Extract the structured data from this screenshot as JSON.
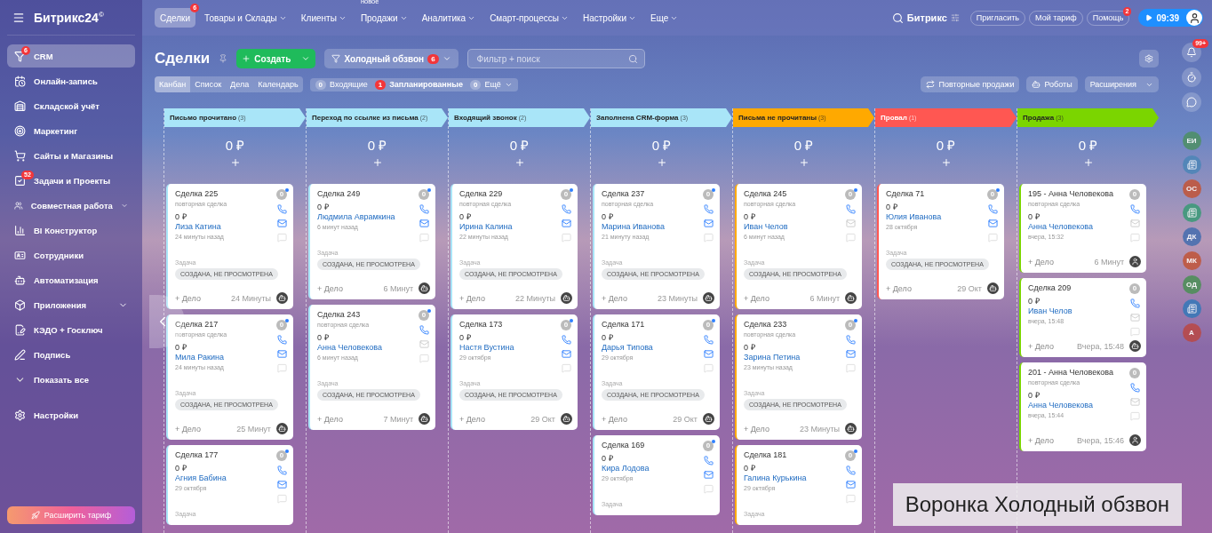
{
  "sidebar": {
    "logo": "Битрикс24",
    "logo_mark": "©",
    "items": [
      {
        "label": "CRM",
        "badge": "6",
        "selected": true,
        "has_submenu": false
      },
      {
        "label": "Онлайн-запись",
        "selected": false,
        "has_submenu": false
      },
      {
        "label": "Складской учёт",
        "selected": false,
        "has_submenu": false
      },
      {
        "label": "Маркетинг",
        "selected": false,
        "has_submenu": false
      },
      {
        "label": "Сайты и Магазины",
        "selected": false,
        "has_submenu": false
      },
      {
        "label": "Задачи и Проекты",
        "badge": "52",
        "selected": false,
        "has_submenu": false
      },
      {
        "label": "Совместная работа",
        "selected": false,
        "has_submenu": true
      },
      {
        "label": "BI Конструктор",
        "selected": false,
        "has_submenu": false
      },
      {
        "label": "Сотрудники",
        "selected": false,
        "has_submenu": false
      },
      {
        "label": "Автоматизация",
        "selected": false,
        "has_submenu": false
      },
      {
        "label": "Приложения",
        "selected": false,
        "has_submenu": true
      },
      {
        "label": "КЭДО + Госключ",
        "selected": false,
        "has_submenu": false
      },
      {
        "label": "Подпись",
        "selected": false,
        "has_submenu": false
      }
    ],
    "show_all": "Показать все",
    "settings": "Настройки",
    "upgrade": "Расширить тариф"
  },
  "nav": {
    "items": [
      {
        "label": "Сделки",
        "badge": "6",
        "selected": true,
        "dropdown": false
      },
      {
        "label": "Товары и Склады",
        "selected": false,
        "dropdown": true
      },
      {
        "label": "Клиенты",
        "selected": false,
        "dropdown": true
      },
      {
        "label": "Продажи",
        "note": "новое",
        "selected": false,
        "dropdown": true
      },
      {
        "label": "Аналитика",
        "selected": false,
        "dropdown": true
      },
      {
        "label": "Смарт-процессы",
        "selected": false,
        "dropdown": true
      },
      {
        "label": "Настройки",
        "selected": false,
        "dropdown": true
      },
      {
        "label": "Еще",
        "selected": false,
        "dropdown": true
      }
    ],
    "portal": "Битрикс",
    "buttons": [
      {
        "label": "Пригласить"
      },
      {
        "label": "Мой тариф"
      },
      {
        "label": "Помощь",
        "badge": "2"
      }
    ],
    "time": "09:39"
  },
  "toolbar": {
    "title": "Сделки",
    "create": "Создать",
    "funnel": "Холодный обзвон",
    "funnel_badge": "6",
    "filter_placeholder": "Фильтр + поиск",
    "views": [
      {
        "label": "Канбан",
        "selected": true
      },
      {
        "label": "Список",
        "selected": false
      },
      {
        "label": "Дела",
        "selected": false
      },
      {
        "label": "Календарь",
        "selected": false
      }
    ],
    "counters": [
      {
        "count": "0",
        "label": "Входящие",
        "alert": false,
        "dropdown": false
      },
      {
        "count": "1",
        "label": "Запланированные",
        "alert": true,
        "dropdown": false
      },
      {
        "count": "0",
        "label": "Ещё",
        "alert": false,
        "dropdown": true
      }
    ],
    "actions": [
      "Повторные продажи",
      "Роботы",
      "Расширения"
    ]
  },
  "board": {
    "columns": [
      {
        "title": "Письмо прочитано",
        "count": "(3)",
        "color": "#a9e5f8",
        "sum": "0 ₽",
        "cards": [
          {
            "title": "Сделка 225",
            "subtitle": "повторная сделка",
            "amount": "0 ₽",
            "contact": "Лиза Катина",
            "time": "24 минуты назад",
            "task_label": "Задача",
            "task_status": "СОЗДАНА, НЕ ПРОСМОТРЕНА",
            "add": "+ Дело",
            "footer_time": "24 Минуты",
            "kind": "robot",
            "counter": "0",
            "unread": true,
            "email_active": true
          },
          {
            "title": "Сделка 217",
            "subtitle": "повторная сделка",
            "amount": "0 ₽",
            "contact": "Мила Ракина",
            "time": "24 минуты назад",
            "task_label": "Задача",
            "task_status": "СОЗДАНА, НЕ ПРОСМОТРЕНА",
            "add": "+ Дело",
            "footer_time": "25 Минут",
            "kind": "robot",
            "counter": "0",
            "unread": true,
            "email_active": true
          },
          {
            "title": "Сделка 177",
            "amount": "0 ₽",
            "contact": "Агния Бабина",
            "time": "29 октября",
            "task_label": "Задача",
            "counter": "0",
            "unread": true,
            "email_active": true
          }
        ]
      },
      {
        "title": "Переход по ссылке из письма",
        "count": "(2)",
        "color": "#a9e5f8",
        "sum": "0 ₽",
        "cards": [
          {
            "title": "Сделка 249",
            "amount": "0 ₽",
            "contact": "Людмила Аврамкина",
            "time": "6 минут назад",
            "task_label": "Задача",
            "task_status": "СОЗДАНА, НЕ ПРОСМОТРЕНА",
            "add": "+ Дело",
            "footer_time": "6 Минут",
            "kind": "robot",
            "counter": "0",
            "unread": true,
            "email_active": true
          },
          {
            "title": "Сделка 243",
            "subtitle": "повторная сделка",
            "amount": "0 ₽",
            "contact": "Анна Человекова",
            "time": "6 минут назад",
            "task_label": "Задача",
            "task_status": "СОЗДАНА, НЕ ПРОСМОТРЕНА",
            "add": "+ Дело",
            "footer_time": "7 Минут",
            "kind": "robot",
            "counter": "0",
            "unread": true,
            "email_active": false
          }
        ]
      },
      {
        "title": "Входящий звонок",
        "count": "(2)",
        "color": "#a9e5f8",
        "sum": "0 ₽",
        "cards": [
          {
            "title": "Сделка 229",
            "subtitle": "повторная сделка",
            "amount": "0 ₽",
            "contact": "Ирина Калина",
            "time": "22 минуты назад",
            "task_label": "Задача",
            "task_status": "СОЗДАНА, НЕ ПРОСМОТРЕНА",
            "add": "+ Дело",
            "footer_time": "22 Минуты",
            "kind": "robot",
            "counter": "0",
            "unread": true,
            "email_active": true
          },
          {
            "title": "Сделка 173",
            "amount": "0 ₽",
            "contact": "Настя Вустина",
            "time": "29 октября",
            "task_label": "Задача",
            "task_status": "СОЗДАНА, НЕ ПРОСМОТРЕНА",
            "add": "+ Дело",
            "footer_time": "29 Окт",
            "kind": "robot",
            "counter": "0",
            "unread": true,
            "email_active": true
          }
        ]
      },
      {
        "title": "Заполнена CRM-форма",
        "count": "(3)",
        "color": "#a9e5f8",
        "sum": "0 ₽",
        "cards": [
          {
            "title": "Сделка 237",
            "subtitle": "повторная сделка",
            "amount": "0 ₽",
            "contact": "Марина Иванова",
            "time": "21 минуту назад",
            "task_label": "Задача",
            "task_status": "СОЗДАНА, НЕ ПРОСМОТРЕНА",
            "add": "+ Дело",
            "footer_time": "23 Минуты",
            "kind": "robot",
            "counter": "0",
            "unread": true,
            "email_active": true
          },
          {
            "title": "Сделка 171",
            "amount": "0 ₽",
            "contact": "Дарья Типова",
            "time": "29 октября",
            "task_label": "Задача",
            "task_status": "СОЗДАНА, НЕ ПРОСМОТРЕНА",
            "add": "+ Дело",
            "footer_time": "29 Окт",
            "kind": "robot",
            "counter": "0",
            "unread": true,
            "email_active": true
          },
          {
            "title": "Сделка 169",
            "amount": "0 ₽",
            "contact": "Кира Лодова",
            "time": "29 октября",
            "task_label": "Задача",
            "counter": "0",
            "unread": true,
            "email_active": true
          }
        ]
      },
      {
        "title": "Письма не прочитаны",
        "count": "(3)",
        "color": "#ffa900",
        "sum": "0 ₽",
        "cards": [
          {
            "title": "Сделка 245",
            "subtitle": "повторная сделка",
            "amount": "0 ₽",
            "contact": "Иван Челов",
            "time": "6 минут назад",
            "task_label": "Задача",
            "task_status": "СОЗДАНА, НЕ ПРОСМОТРЕНА",
            "add": "+ Дело",
            "footer_time": "6 Минут",
            "kind": "robot",
            "counter": "0",
            "unread": true,
            "email_active": false
          },
          {
            "title": "Сделка 233",
            "subtitle": "повторная сделка",
            "amount": "0 ₽",
            "contact": "Зарина Петина",
            "time": "23 минуты назад",
            "task_label": "Задача",
            "task_status": "СОЗДАНА, НЕ ПРОСМОТРЕНА",
            "add": "+ Дело",
            "footer_time": "23 Минуты",
            "kind": "robot",
            "counter": "0",
            "unread": true,
            "email_active": true
          },
          {
            "title": "Сделка 181",
            "amount": "0 ₽",
            "contact": "Галина Курькина",
            "time": "29 октября",
            "task_label": "Задача",
            "counter": "0",
            "unread": true,
            "email_active": true
          }
        ]
      },
      {
        "title": "Провал",
        "count": "(1)",
        "color": "#ff5752",
        "sum": "0 ₽",
        "cards": [
          {
            "title": "Сделка 71",
            "amount": "0 ₽",
            "contact": "Юлия Иванова",
            "time": "28 октября",
            "task_label": "Задача",
            "task_status": "СОЗДАНА, НЕ ПРОСМОТРЕНА",
            "add": "+ Дело",
            "footer_time": "29 Окт",
            "kind": "robot",
            "counter": "0",
            "unread": true,
            "email_active": true
          }
        ]
      },
      {
        "title": "Продажа",
        "count": "(3)",
        "color": "#7bd500",
        "sum": "0 ₽",
        "cards": [
          {
            "title": "195 - Анна Человекова",
            "subtitle": "повторная сделка",
            "amount": "0 ₽",
            "contact": "Анна Человекова",
            "time": "вчера, 15:32",
            "add": "+ Дело",
            "footer_time": "6 Минут",
            "kind": "person",
            "counter": "0",
            "unread": false,
            "email_active": false
          },
          {
            "title": "Сделка 209",
            "amount": "0 ₽",
            "contact": "Иван Челов",
            "time": "вчера, 15:48",
            "add": "+ Дело",
            "footer_time": "Вчера, 15:48",
            "kind": "robot",
            "counter": "0",
            "unread": false,
            "email_active": false
          },
          {
            "title": "201 - Анна Человекова",
            "subtitle": "повторная сделка",
            "amount": "0 ₽",
            "contact": "Анна Человекова",
            "time": "вчера, 15:44",
            "add": "+ Дело",
            "footer_time": "Вчера, 15:46",
            "kind": "person",
            "counter": "0",
            "unread": false,
            "email_active": false
          }
        ]
      }
    ]
  },
  "rail": {
    "bell_badge": "99+",
    "contacts": [
      {
        "kind": "initials",
        "initials": "ЕИ",
        "color": "#4f8f6a"
      },
      {
        "kind": "icon",
        "color": "#4f86b8"
      },
      {
        "kind": "initials",
        "initials": "ОС",
        "color": "#c0583f"
      },
      {
        "kind": "icon",
        "color": "#3f9a7a"
      },
      {
        "kind": "initials",
        "initials": "ДК",
        "color": "#4a6fb0"
      },
      {
        "kind": "initials",
        "initials": "МК",
        "color": "#c0583f"
      },
      {
        "kind": "initials",
        "initials": "ОД",
        "color": "#4f8f5a"
      },
      {
        "kind": "icon",
        "color": "#3a78b8"
      },
      {
        "kind": "initials",
        "initials": "А",
        "color": "#b84a4a"
      }
    ]
  },
  "caption": "Воронка Холодный обзвон"
}
